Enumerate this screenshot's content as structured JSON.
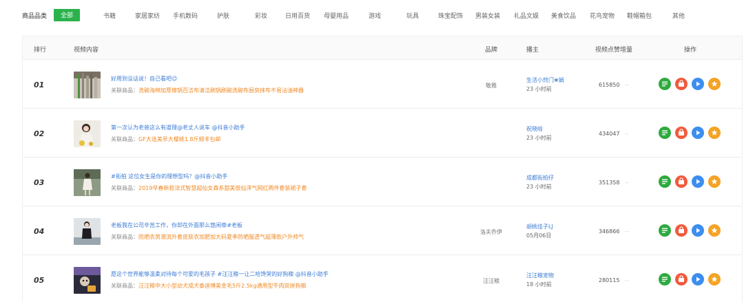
{
  "categories": {
    "label": "商品品类",
    "items": [
      "全部",
      "书籍",
      "家居家纺",
      "手机数码",
      "护肤",
      "彩妆",
      "日用百货",
      "母婴用品",
      "游戏",
      "玩具",
      "珠宝配饰",
      "男装女装",
      "礼品文娱",
      "美食饮品",
      "花鸟宠物",
      "鞋帽箱包",
      "其他"
    ],
    "active": "全部"
  },
  "table": {
    "headers": {
      "rank": "排行",
      "video": "视频内容",
      "brand": "品牌",
      "anchor": "播主",
      "likes": "视频点赞增量",
      "actions": "操作"
    },
    "product_prefix": "关联商品：",
    "rows": [
      {
        "rank": "01",
        "title": "好用到没话说！自己看吧😉",
        "product": "洗碗海绵加厚擦锅百洁布清洁刷锅刷碗洗碗布厨房抹布不易沾油神器",
        "brand": "敬雅",
        "anchor": "生活小窍门❀娟",
        "time": "23 小时前",
        "likes": "615850",
        "trend": "--"
      },
      {
        "rank": "02",
        "title": "第一次认为老爸这么有道理@老丈人说车 @抖音小助手",
        "product": "GF大连美早大樱桃1.8斤顺丰包邮",
        "brand": "",
        "anchor": "祝晓晗",
        "time": "23 小时前",
        "likes": "434047",
        "trend": "--"
      },
      {
        "rank": "03",
        "title": "#街拍 这位女生是你的理想型吗？@抖音小助手",
        "product": "2019早春新款法式智慧超仙女森系甜美很仙洋气网红两件套装裙子套",
        "brand": "",
        "anchor": "成都街拍仔",
        "time": "23 小时前",
        "likes": "351358",
        "trend": "--"
      },
      {
        "rank": "04",
        "title": "老板我在公司辛苦工作，你却在外面那么悠闲😨#老板",
        "product": "防晒衣男潮流外套皮肤衣加肥加大码夏季防晒服透气超薄款户外帅气",
        "brand": "洛夫乔伊",
        "anchor": "胡桃佳子LJ",
        "time": "05月06日",
        "likes": "346866",
        "trend": "--"
      },
      {
        "rank": "05",
        "title": "愿这个世界能够温柔对待每个可爱的毛孩子 #汪汪粮一让二哈馋哭的好狗粮 @抖音小助手",
        "product": "汪汪粮中大小型幼犬成犬泰迪博美金毛5斤2.5kg通用型牛肉双拼狗粮",
        "brand": "汪汪粮",
        "anchor": "汪汪粮宠物",
        "time": "18 小时前",
        "likes": "280115",
        "trend": "--"
      }
    ]
  },
  "action_icons": [
    "list-icon",
    "shop-bag-icon",
    "play-icon",
    "star-icon"
  ],
  "colors": {
    "accent_green": "#2bb24c",
    "link_blue": "#3a7bd5",
    "product_orange": "#f08a24",
    "action_green": "#2eaa3f",
    "action_red": "#f25a3c",
    "action_blue": "#3c8ef0",
    "action_orange": "#f4a326"
  }
}
